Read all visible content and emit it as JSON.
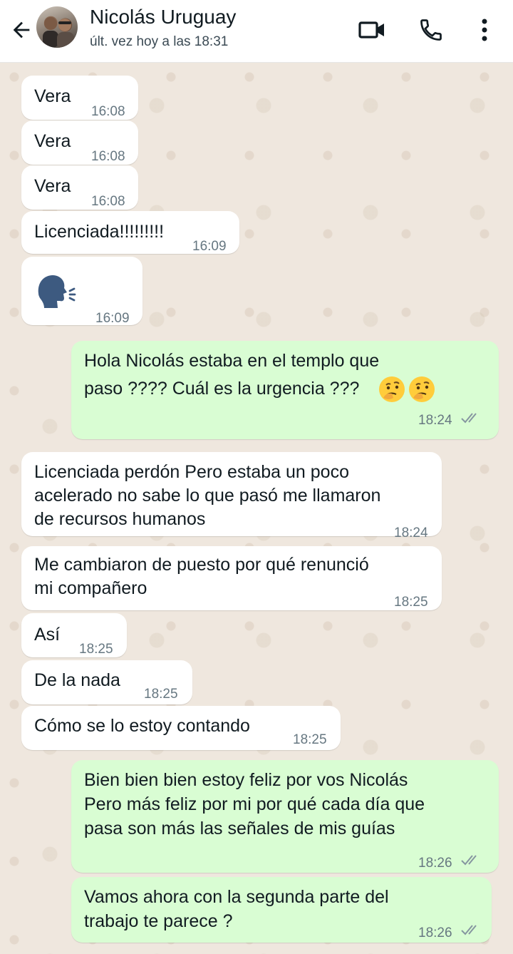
{
  "header": {
    "back_icon": "arrow-left-icon",
    "contact_name": "Nicolás Uruguay",
    "last_seen": "últ. vez hoy a las 18:31",
    "video_icon": "video-camera-icon",
    "call_icon": "phone-icon",
    "menu_icon": "more-vertical-icon"
  },
  "colors": {
    "incoming_bubble": "#ffffff",
    "outgoing_bubble": "#d9fdd3",
    "chat_background": "#efe7de",
    "read_ticks": "#8696a0"
  },
  "messages": [
    {
      "direction": "in",
      "text": "Vera",
      "time": "16:08"
    },
    {
      "direction": "in",
      "text": "Vera",
      "time": "16:08"
    },
    {
      "direction": "in",
      "text": "Vera",
      "time": "16:08"
    },
    {
      "direction": "in",
      "text": "Licenciada!!!!!!!!!",
      "time": "16:09"
    },
    {
      "direction": "in",
      "type": "emoji",
      "icon": "speaking-head-icon",
      "time": "16:09"
    },
    {
      "direction": "out",
      "lines": [
        "Hola Nicolás estaba en el templo que",
        "paso ???? Cuál es la urgencia ???"
      ],
      "emoji_icons": [
        "thinking-face-icon",
        "thinking-face-icon"
      ],
      "time": "18:24",
      "status": "double-check-icon"
    },
    {
      "direction": "in",
      "lines": [
        "Licenciada perdón Pero estaba un poco",
        "acelerado no sabe lo que pasó me llamaron",
        "de recursos humanos"
      ],
      "time": "18:24"
    },
    {
      "direction": "in",
      "lines": [
        "Me cambiaron de puesto por qué renunció",
        "mi compañero"
      ],
      "time": "18:25"
    },
    {
      "direction": "in",
      "text": "Así",
      "time": "18:25"
    },
    {
      "direction": "in",
      "text": "De la nada",
      "time": "18:25"
    },
    {
      "direction": "in",
      "text": "Cómo se lo estoy contando",
      "time": "18:25"
    },
    {
      "direction": "out",
      "lines": [
        "Bien bien bien estoy feliz por vos Nicolás",
        "Pero más feliz por mi por qué cada día que",
        "pasa son más las señales de mis guías"
      ],
      "time": "18:26",
      "status": "double-check-icon"
    },
    {
      "direction": "out",
      "lines": [
        "Vamos ahora con la segunda parte del",
        "trabajo te parece ?"
      ],
      "time": "18:26",
      "status": "double-check-icon"
    }
  ]
}
